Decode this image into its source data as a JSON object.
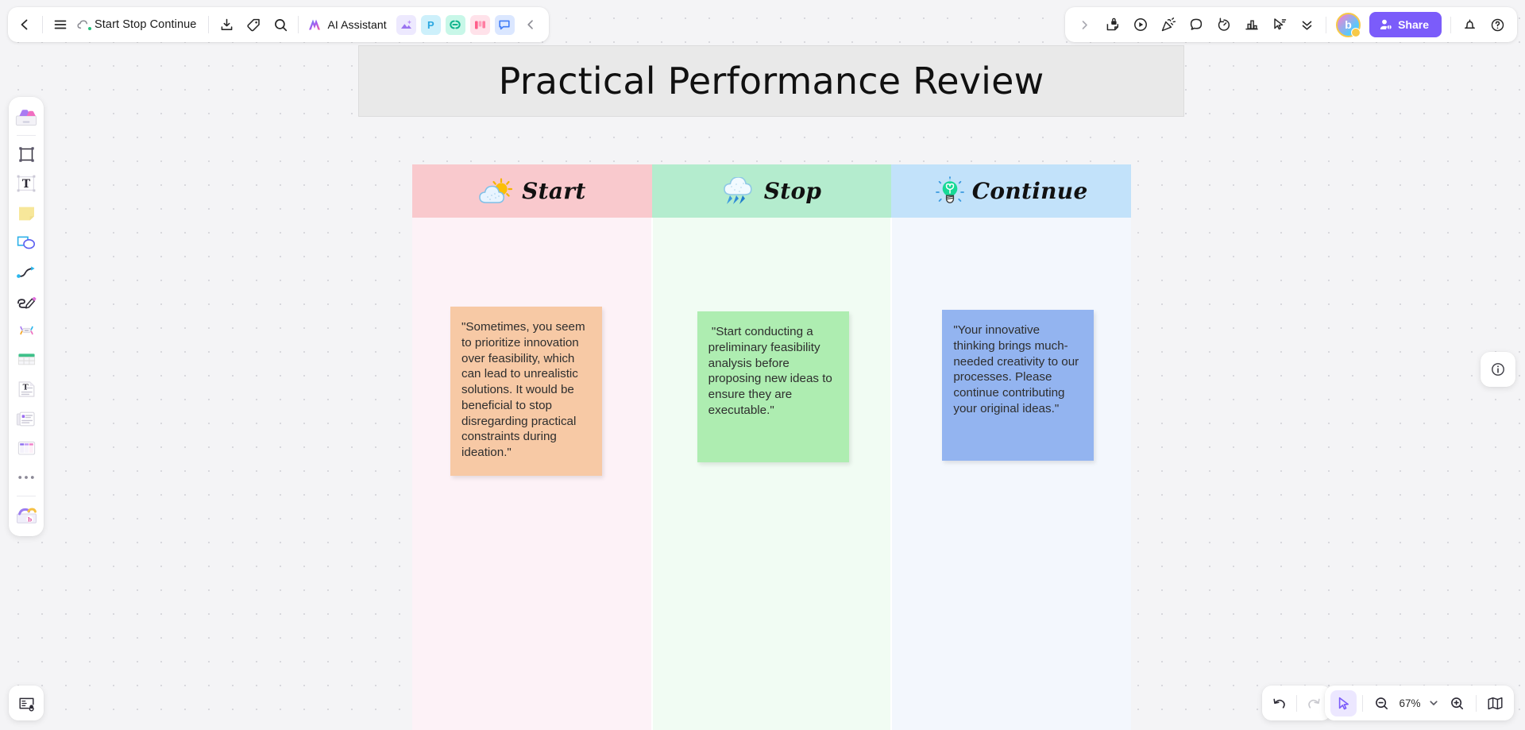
{
  "app": {
    "board_title": "Start Stop Continue",
    "zoom_level": "67%",
    "share_label": "Share",
    "ai_assistant_label": "AI Assistant",
    "avatar_initial": "b"
  },
  "topbar": {
    "back_icon": "chevron-left-icon",
    "menu_icon": "hamburger-menu-icon",
    "cloud_icon": "cloud-saved-icon",
    "export_icon": "download-export-icon",
    "tag_icon": "tag-icon",
    "search_icon": "search-icon",
    "ai_icon": "ai-sparkle-icon",
    "collapse_icon": "chevron-left-collapse-icon",
    "app_chips": [
      {
        "name": "image-app-chip",
        "label": "",
        "bg": "#ede9fe",
        "fg": "#8b5cf6"
      },
      {
        "name": "presentation-app-chip",
        "label": "P",
        "bg": "#cdf0fb",
        "fg": "#2aa7e0"
      },
      {
        "name": "link-app-chip",
        "label": "",
        "bg": "#c8f7e8",
        "fg": "#0fb48c"
      },
      {
        "name": "kanban-app-chip",
        "label": "",
        "bg": "#ffe2ea",
        "fg": "#ff5e8a"
      },
      {
        "name": "comment-app-chip",
        "label": "",
        "bg": "#dbe7ff",
        "fg": "#3f7cf6"
      }
    ]
  },
  "right_cluster": {
    "expand_icon": "chevron-right-icon",
    "tools": [
      {
        "name": "sticky-lock-icon"
      },
      {
        "name": "play-circle-icon"
      },
      {
        "name": "celebrate-confetti-icon"
      },
      {
        "name": "comment-bubble-icon"
      },
      {
        "name": "timer-icon"
      },
      {
        "name": "chart-vote-icon"
      },
      {
        "name": "cursor-flag-icon"
      },
      {
        "name": "chevron-double-down-icon"
      }
    ],
    "notification_icon": "bell-icon",
    "help_icon": "help-circle-icon"
  },
  "left_rail": {
    "items": [
      {
        "name": "templates-icon",
        "label": "Templates"
      },
      {
        "name": "frame-icon",
        "label": "Frame"
      },
      {
        "name": "text-icon",
        "label": "Text"
      },
      {
        "name": "sticky-note-icon",
        "label": "Sticky note"
      },
      {
        "name": "shapes-icon",
        "label": "Shapes"
      },
      {
        "name": "connector-line-icon",
        "label": "Connector"
      },
      {
        "name": "pen-draw-icon",
        "label": "Pen"
      },
      {
        "name": "mindmap-icon",
        "label": "Mind map"
      },
      {
        "name": "table-icon",
        "label": "Table"
      },
      {
        "name": "document-icon",
        "label": "Document"
      },
      {
        "name": "card-stack-icon",
        "label": "Cards"
      },
      {
        "name": "kanban-board-icon",
        "label": "Kanban"
      },
      {
        "name": "more-tools-icon",
        "label": "More"
      },
      {
        "name": "apps-box-icon",
        "label": "Apps"
      }
    ]
  },
  "bottom_left": {
    "present_icon": "presentation-mode-icon"
  },
  "right_info": {
    "info_icon": "info-circle-icon"
  },
  "bottom_right": {
    "undo_icon": "undo-arrow-icon",
    "redo_icon": "redo-arrow-icon",
    "select_icon": "cursor-select-icon",
    "zoom_out_icon": "zoom-out-icon",
    "zoom_in_icon": "zoom-in-icon",
    "zoom_chevron_icon": "chevron-down-icon",
    "minimap_icon": "minimap-icon"
  },
  "board": {
    "heading": "Practical Performance Review",
    "columns": [
      {
        "key": "start",
        "title": "Start",
        "icon": "sun-behind-cloud-icon",
        "header_bg": "#f9c9cd",
        "body_bg": "#fdf2f7",
        "note": {
          "text": "\"Sometimes, you seem to prioritize innovation over feasibility, which can lead to unrealistic solutions. It would be beneficial to stop disregarding practical constraints during ideation.\"",
          "color": "#f7c9a5"
        }
      },
      {
        "key": "stop",
        "title": "Stop",
        "icon": "rain-cloud-icon",
        "header_bg": "#b4ecce",
        "body_bg": "#f1fcf3",
        "note": {
          "text": " \"Start conducting a preliminary feasibility analysis before proposing new ideas to ensure they are executable.\"",
          "color": "#aeedb1"
        }
      },
      {
        "key": "continue",
        "title": "Continue",
        "icon": "lightbulb-idea-icon",
        "header_bg": "#c2e2fa",
        "body_bg": "#f3f7fd",
        "note": {
          "text": "\"Your innovative thinking brings much-needed creativity to our processes. Please continue contributing your original ideas.\"",
          "color": "#93b4f0"
        }
      }
    ]
  }
}
